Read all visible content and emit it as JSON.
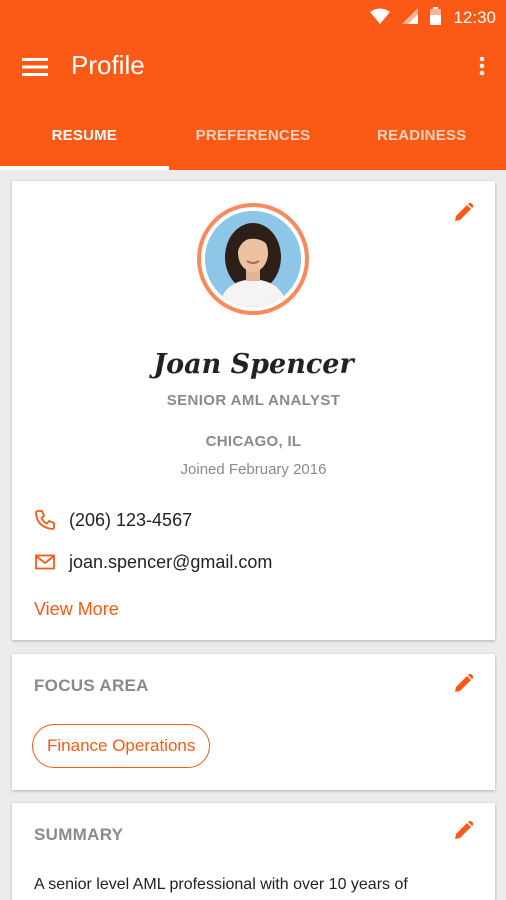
{
  "status_bar": {
    "time": "12:30"
  },
  "toolbar": {
    "title": "Profile"
  },
  "tabs": [
    {
      "label": "RESUME",
      "active": true
    },
    {
      "label": "PREFERENCES",
      "active": false
    },
    {
      "label": "READINESS",
      "active": false
    }
  ],
  "profile": {
    "name": "Joan Spencer",
    "job_title": "SENIOR AML ANALYST",
    "location": "CHICAGO, IL",
    "joined": "Joined February 2016",
    "phone": "(206) 123-4567",
    "email": "joan.spencer@gmail.com",
    "view_more_label": "View More"
  },
  "focus_area": {
    "title": "FOCUS AREA",
    "chips": [
      "Finance Operations"
    ]
  },
  "summary": {
    "title": "SUMMARY",
    "text": "A senior level AML professional with over 10 years of"
  },
  "colors": {
    "accent": "#fb5a16",
    "avatar_ring": "#fb8a5a",
    "muted_text": "#8a8a8a",
    "background": "#ececec"
  },
  "icons": {
    "menu": "hamburger-menu-icon",
    "overflow": "more-vertical-icon",
    "edit": "pencil-icon",
    "phone": "phone-icon",
    "email": "envelope-icon",
    "wifi": "wifi-icon",
    "cell": "cell-signal-icon",
    "battery": "battery-icon"
  }
}
